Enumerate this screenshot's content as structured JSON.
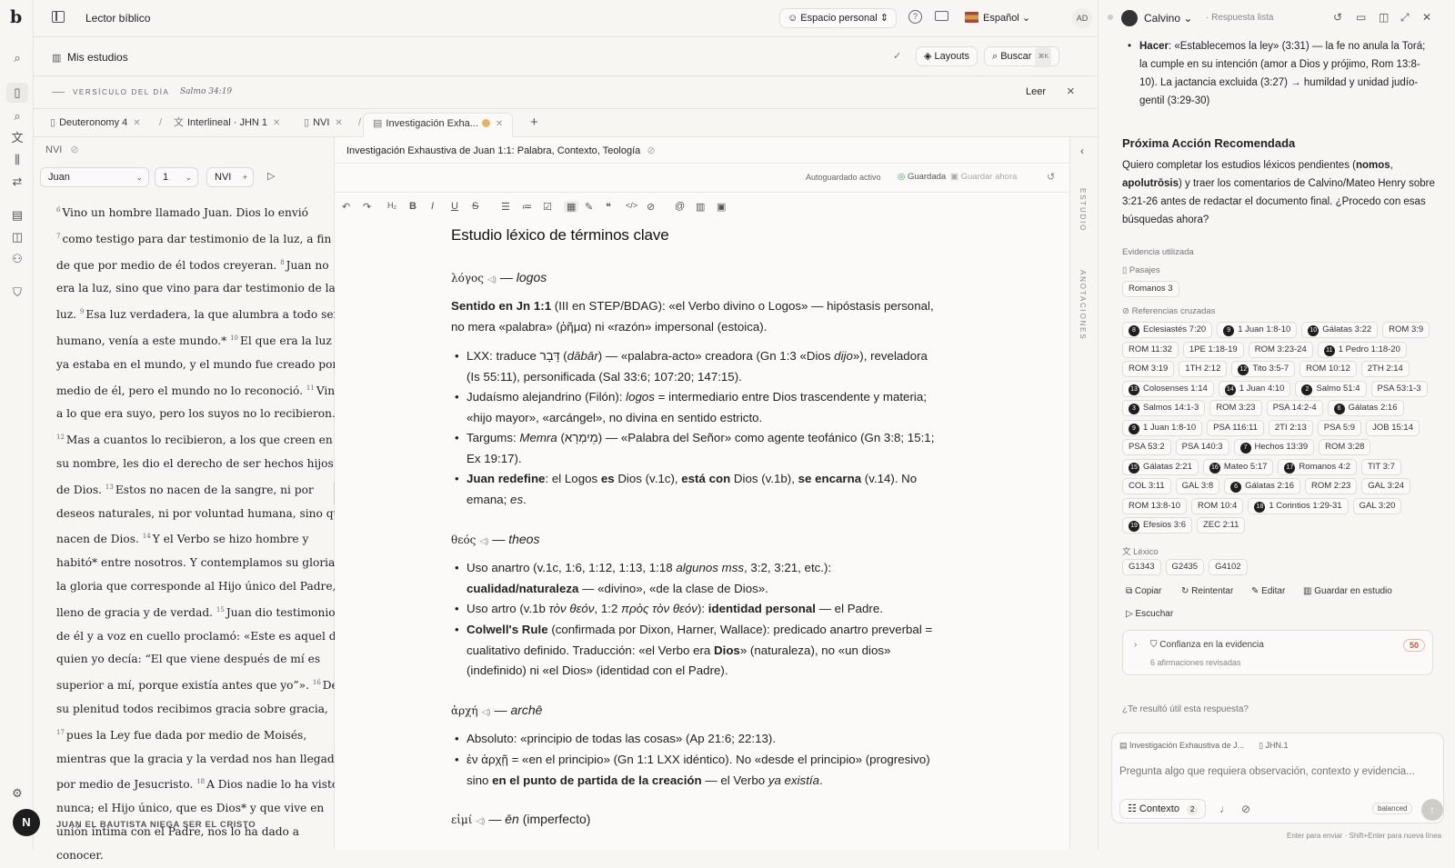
{
  "app": {
    "title": "Lector bíblico",
    "logo": "b"
  },
  "topbar": {
    "workspace": "Espacio personal",
    "language": "Español",
    "avatar": "AD"
  },
  "studies": {
    "title": "Mis estudios",
    "layouts": "Layouts",
    "search": "Buscar",
    "search_kbd": "⌘K"
  },
  "votd": {
    "label": "VERSÍCULO DEL DÍA",
    "ref": "Salmo 34:19",
    "read": "Leer"
  },
  "tabs": [
    {
      "label": "Deuteronomy 4"
    },
    {
      "label": "Interlineal · JHN 1"
    },
    {
      "label": "NVI"
    },
    {
      "label": "Investigación Exha..."
    }
  ],
  "left": {
    "version_label": "NVI",
    "book": "Juan",
    "chapter": "1",
    "version": "NVI",
    "section_heading": "JUAN EL BAUTISTA NIEGA SER EL CRISTO"
  },
  "scripture": [
    {
      "num": "6",
      "text": "Vino un hombre llamado Juan. Dios lo envió"
    },
    {
      "num": "7",
      "text": "como testigo para dar testimonio de la luz, a fin de que por medio de él todos creyeran."
    },
    {
      "num": "8",
      "text": "Juan no era la luz, sino que vino para dar testimonio de la luz."
    },
    {
      "num": "9",
      "text": "Esa luz verdadera, la que alumbra a todo ser humano, venía a este mundo.*"
    },
    {
      "num": "10",
      "text": "El que era la luz ya estaba en el mundo, y el mundo fue creado por medio de él, pero el mundo no lo reconoció."
    },
    {
      "num": "11",
      "text": "Vino a lo que era suyo, pero los suyos no lo recibieron."
    },
    {
      "num": "12",
      "text": "Mas a cuantos lo recibieron, a los que creen en su nombre, les dio el derecho de ser hechos hijos de Dios."
    },
    {
      "num": "13",
      "text": "Estos no nacen de la sangre, ni por deseos naturales, ni por voluntad humana, sino que nacen de Dios."
    },
    {
      "num": "14",
      "text": "Y el Verbo se hizo hombre y habitó* entre nosotros. Y contemplamos su gloria, la gloria que corresponde al Hijo único del Padre, lleno de gracia y de verdad."
    },
    {
      "num": "15",
      "text": "Juan dio testimonio de él y a voz en cuello proclamó: «Este es aquel de quien yo decía: “El que viene después de mí es superior a mí, porque existía antes que yo”»."
    },
    {
      "num": "16",
      "text": "De su plenitud todos recibimos gracia sobre gracia,"
    },
    {
      "num": "17",
      "text": "pues la Ley fue dada por medio de Moisés, mientras que la gracia y la verdad nos han llegado por medio de Jesucristo."
    },
    {
      "num": "18",
      "text": "A Dios nadie lo ha visto nunca; el Hijo único, que es Dios* y que vive en unión íntima con el Padre, nos lo ha dado a conocer."
    }
  ],
  "doc": {
    "title": "Investigación Exhaustiva de Juan 1:1: Palabra, Contexto, Teología",
    "autosave": "Autoguardado activo",
    "saved": "Guardada",
    "save_now": "Guardar ahora",
    "heading": "Estudio léxico de términos clave"
  },
  "collapse": {
    "study": "ESTUDIO",
    "notes": "ANOTACIONES"
  },
  "chat": {
    "agent": "Calvino",
    "status": "· Respuesta lista",
    "intro": "«Establecemos la ley» (3:31) — la fe no anula la Torá; la cumple en su intención (amor a Dios y prójimo, Rom 13:8-10). La jactancia excluida (3:27) → humildad y unidad judío-gentil (3:29-30)",
    "intro_bold": "Hacer",
    "next_title": "Próxima Acción Recomendada",
    "evidence_label": "Evidencia utilizada",
    "passages_label": "Pasajes",
    "passages": [
      "Romanos 3"
    ],
    "xref_label": "Referencias cruzadas",
    "lex_label": "Léxico",
    "lexicon": [
      "G1343",
      "G2435",
      "G4102"
    ],
    "actions": {
      "copy": "Copiar",
      "retry": "Reintentar",
      "edit": "Editar",
      "save": "Guardar en estudio",
      "listen": "Escuchar"
    },
    "confidence": {
      "title": "Confianza en la evidencia",
      "sub": "6 afirmaciones revisadas",
      "score": "50"
    },
    "feedback": "¿Te resultó útil esta respuesta?",
    "ctx_doc": "Investigación Exhaustiva de J...",
    "ctx_ref": "JHN.1",
    "placeholder": "Pregunta algo que requiera observación, contexto y evidencia...",
    "context_btn": "Contexto",
    "context_count": "2",
    "mode": "balanced",
    "hint": "Enter para enviar · Shift+Enter para nueva línea"
  },
  "xrefs": [
    {
      "n": "8",
      "t": "Eclesiastés 7:20"
    },
    {
      "n": "9",
      "t": "1 Juan 1:8-10"
    },
    {
      "n": "10",
      "t": "Gálatas 3:22"
    },
    {
      "t": "ROM 3:9"
    },
    {
      "t": "ROM 11:32"
    },
    {
      "t": "1PE 1:18-19"
    },
    {
      "t": "ROM 3:23-24"
    },
    {
      "n": "11",
      "t": "1 Pedro 1:18-20"
    },
    {
      "t": "ROM 3:19"
    },
    {
      "t": "1TH 2:12"
    },
    {
      "n": "12",
      "t": "Tito 3:5-7"
    },
    {
      "t": "ROM 10:12"
    },
    {
      "t": "2TH 2:14"
    },
    {
      "n": "13",
      "t": "Colosenses 1:14"
    },
    {
      "n": "14",
      "t": "1 Juan 4:10"
    },
    {
      "n": "2",
      "t": "Salmo 51:4"
    },
    {
      "t": "PSA 53:1-3"
    },
    {
      "n": "3",
      "t": "Salmos 14:1-3"
    },
    {
      "t": "ROM 3:23"
    },
    {
      "t": "PSA 14:2-4"
    },
    {
      "n": "6",
      "t": "Gálatas 2:16"
    },
    {
      "n": "9",
      "t": "1 Juan 1:8-10"
    },
    {
      "t": "PSA 116:11"
    },
    {
      "t": "2TI 2:13"
    },
    {
      "t": "PSA 5:9"
    },
    {
      "t": "JOB 15:14"
    },
    {
      "t": "PSA 53:2"
    },
    {
      "t": "PSA 140:3"
    },
    {
      "n": "7",
      "t": "Hechos 13:39"
    },
    {
      "t": "ROM 3:28"
    },
    {
      "n": "15",
      "t": "Gálatas 2:21"
    },
    {
      "n": "16",
      "t": "Mateo 5:17"
    },
    {
      "n": "17",
      "t": "Romanos 4:2"
    },
    {
      "t": "TIT 3:7"
    },
    {
      "t": "COL 3:11"
    },
    {
      "t": "GAL 3:8"
    },
    {
      "n": "6",
      "t": "Gálatas 2:16"
    },
    {
      "t": "ROM 2:23"
    },
    {
      "t": "GAL 3:24"
    },
    {
      "t": "ROM 13:8-10"
    },
    {
      "t": "ROM 10:4"
    },
    {
      "n": "18",
      "t": "1 Corintios 1:29-31"
    },
    {
      "t": "GAL 3:20"
    },
    {
      "n": "19",
      "t": "Efesios 3:6"
    },
    {
      "t": "ZEC 2:11"
    }
  ]
}
